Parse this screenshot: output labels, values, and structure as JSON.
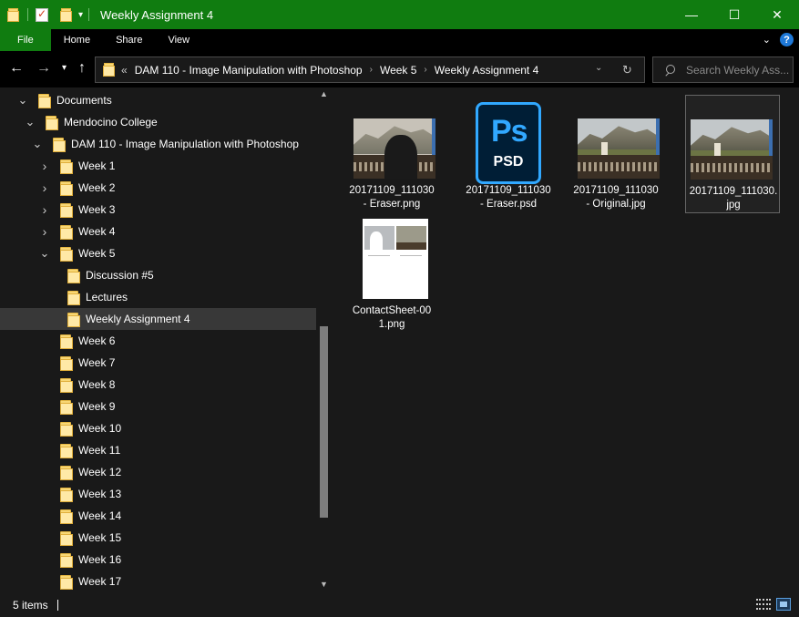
{
  "window": {
    "title": "Weekly Assignment 4",
    "controls": {
      "minimize": "—",
      "maximize": "☐",
      "close": "✕"
    }
  },
  "ribbon": {
    "tabs": [
      "File",
      "Home",
      "Share",
      "View"
    ],
    "help": "?"
  },
  "address": {
    "overflow": "«",
    "crumbs": [
      "DAM 110 - Image Manipulation with Photoshop",
      "Week 5",
      "Weekly Assignment 4"
    ],
    "search_placeholder": "Search Weekly Ass..."
  },
  "nav_tree": [
    {
      "label": "Documents",
      "level": 0,
      "expanded": true
    },
    {
      "label": "Mendocino College",
      "level": 1,
      "expanded": true
    },
    {
      "label": "DAM 110 - Image Manipulation with Photoshop",
      "level": 2,
      "expanded": true
    },
    {
      "label": "Week 1",
      "level": 3,
      "expanded": false
    },
    {
      "label": "Week 2",
      "level": 3,
      "expanded": false
    },
    {
      "label": "Week 3",
      "level": 3,
      "expanded": false
    },
    {
      "label": "Week 4",
      "level": 3,
      "expanded": false
    },
    {
      "label": "Week 5",
      "level": 3,
      "expanded": true
    },
    {
      "label": "Discussion #5",
      "level": 4,
      "expanded": null
    },
    {
      "label": "Lectures",
      "level": 4,
      "expanded": null
    },
    {
      "label": "Weekly Assignment 4",
      "level": 4,
      "expanded": null,
      "selected": true
    },
    {
      "label": "Week 6",
      "level": 3,
      "expanded": null
    },
    {
      "label": "Week 7",
      "level": 3,
      "expanded": null
    },
    {
      "label": "Week 8",
      "level": 3,
      "expanded": null
    },
    {
      "label": "Week 9",
      "level": 3,
      "expanded": null
    },
    {
      "label": "Week 10",
      "level": 3,
      "expanded": null
    },
    {
      "label": "Week 11",
      "level": 3,
      "expanded": null
    },
    {
      "label": "Week 12",
      "level": 3,
      "expanded": null
    },
    {
      "label": "Week 13",
      "level": 3,
      "expanded": null
    },
    {
      "label": "Week 14",
      "level": 3,
      "expanded": null
    },
    {
      "label": "Week 15",
      "level": 3,
      "expanded": null
    },
    {
      "label": "Week 16",
      "level": 3,
      "expanded": null
    },
    {
      "label": "Week 17",
      "level": 3,
      "expanded": null
    }
  ],
  "files": [
    {
      "line1": "20171109_111030",
      "line2": "- Eraser.png",
      "kind": "eraser-photo"
    },
    {
      "line1": "20171109_111030",
      "line2": "- Eraser.psd",
      "kind": "psd",
      "icon_text": "Ps",
      "icon_ext": "PSD"
    },
    {
      "line1": "20171109_111030",
      "line2": "- Original.jpg",
      "kind": "photo"
    },
    {
      "line1": "20171109_111030.",
      "line2": "jpg",
      "kind": "photo",
      "selected": true
    },
    {
      "line1": "ContactSheet-00",
      "line2": "1.png",
      "kind": "contact-sheet"
    }
  ],
  "status": {
    "count": "5 items"
  },
  "colors": {
    "accent": "#107c10",
    "background": "#191919",
    "selection": "#383838",
    "ps_blue": "#31a8ff"
  }
}
